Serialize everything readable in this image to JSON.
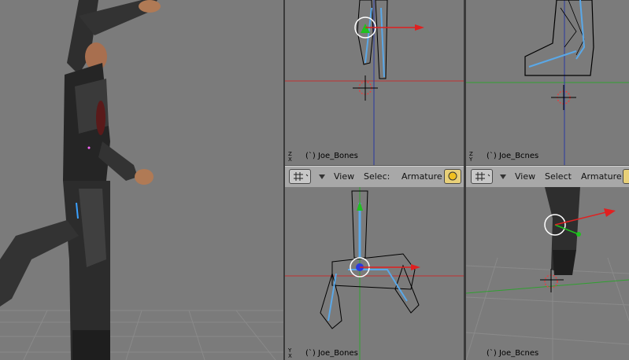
{
  "viewports": {
    "top_left": {
      "object_label": "(`) Joe_Bones",
      "axis_label": "Z X"
    },
    "top_right": {
      "object_label": "(`) Joe_Bcnes",
      "axis_label": "Z Y"
    },
    "bottom_left": {
      "object_label": "(`) Joe_Bones",
      "axis_label": "Y X"
    },
    "bottom_right": {
      "object_label": "(`) Joe_Bcnes"
    }
  },
  "headers": {
    "left": {
      "view": "View",
      "select": "Selec:",
      "mode": "Armature"
    },
    "right": {
      "view": "View",
      "select": "Select",
      "mode": "Armature"
    }
  },
  "colors": {
    "viewport_bg": "#7b7b7b",
    "header_bg": "#a8a8a8",
    "x_axis": "#e02020",
    "bone": "#5aa8e8",
    "y_axis": "#20c020"
  }
}
